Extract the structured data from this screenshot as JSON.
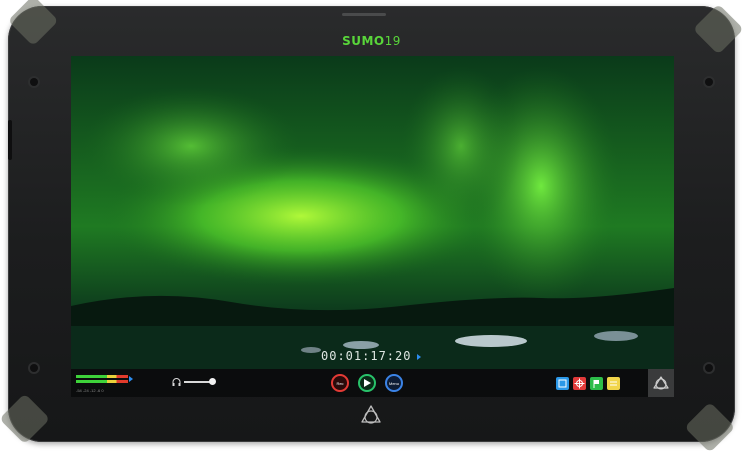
{
  "device": {
    "brand_name": "SUMO",
    "brand_model": "19"
  },
  "overlay": {
    "timecode": "00:01:17:20"
  },
  "bottom_bar": {
    "audio_meter_scale": "-54 -24 -12 -6 0",
    "buttons": {
      "rec_label": "Rec",
      "play_label": "",
      "menu_label": "Menu"
    },
    "quick_tiles": [
      "waveform-tile",
      "focus-tile",
      "flag-tile",
      "note-tile"
    ]
  },
  "colors": {
    "brand_green": "#59d63a",
    "rec_red": "#e33a35",
    "play_green": "#28c26a",
    "menu_blue": "#3b83e6"
  },
  "icons": {
    "headphone": "headphone-icon",
    "atomos_logo": "atomos-logo-icon"
  }
}
